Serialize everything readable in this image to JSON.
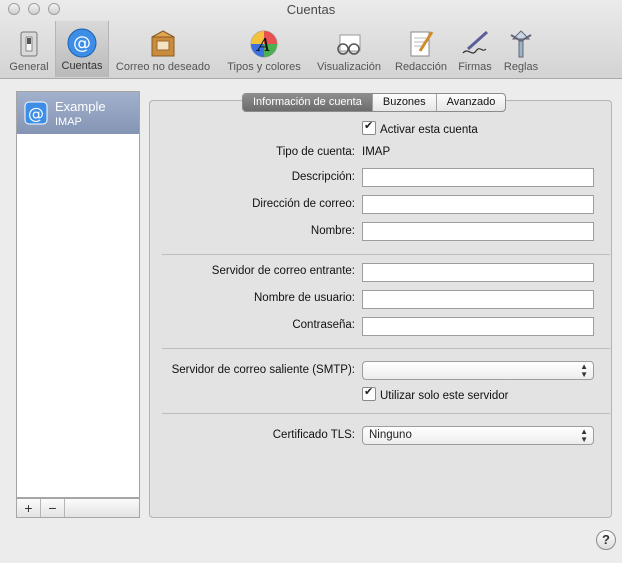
{
  "window": {
    "title": "Cuentas"
  },
  "toolbar": {
    "items": [
      {
        "label": "General",
        "icon": "switch-icon"
      },
      {
        "label": "Cuentas",
        "icon": "at-icon"
      },
      {
        "label": "Correo no deseado",
        "icon": "junk-mail-icon"
      },
      {
        "label": "Tipos y colores",
        "icon": "fonts-colors-icon"
      },
      {
        "label": "Visualización",
        "icon": "viewing-glasses-icon"
      },
      {
        "label": "Redacción",
        "icon": "composing-icon"
      },
      {
        "label": "Firmas",
        "icon": "signature-pen-icon"
      },
      {
        "label": "Reglas",
        "icon": "rules-icon"
      }
    ],
    "selected": "Cuentas"
  },
  "accounts": [
    {
      "name": "Example",
      "type": "IMAP"
    }
  ],
  "list_footer": {
    "add": "+",
    "remove": "−"
  },
  "tabs": [
    {
      "label": "Información de cuenta"
    },
    {
      "label": "Buzones"
    },
    {
      "label": "Avanzado"
    }
  ],
  "form": {
    "activate_label": "Activar esta cuenta",
    "account_type_label": "Tipo de cuenta:",
    "account_type_value": "IMAP",
    "description_label": "Descripción:",
    "description_value": "",
    "email_label": "Dirección de correo:",
    "email_value": "",
    "name_label": "Nombre:",
    "name_value": "",
    "incoming_label": "Servidor de correo entrante:",
    "incoming_value": "",
    "username_label": "Nombre de usuario:",
    "username_value": "",
    "password_label": "Contraseña:",
    "password_value": "",
    "smtp_label": "Servidor de correo saliente (SMTP):",
    "smtp_value": "",
    "only_server_label": "Utilizar solo este servidor",
    "tls_label": "Certificado TLS:",
    "tls_value": "Ninguno"
  },
  "help": "?"
}
